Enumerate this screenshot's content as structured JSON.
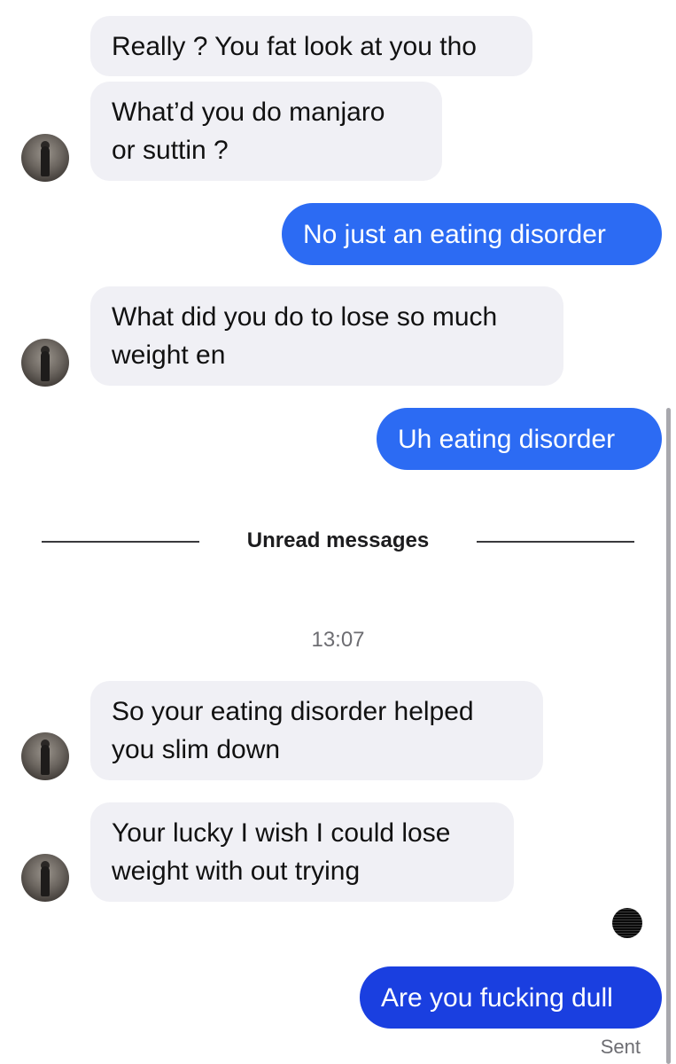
{
  "messages": {
    "m1": "Really ? You fat look at you tho",
    "m2": "What’d you do manjaro\nor suttin ?",
    "m3": "No just an eating disorder",
    "m4": "What did you do to lose so much\nweight en",
    "m5": "Uh eating disorder",
    "m6": "So your eating disorder helped\nyou slim down",
    "m7": "Your lucky I wish I could lose\nweight with out trying",
    "m8": "Are you fucking dull"
  },
  "divider": {
    "label": "Unread messages"
  },
  "timestamp": "13:07",
  "status": {
    "sent": "Sent"
  },
  "colors": {
    "incoming_bubble": "#f0f0f5",
    "outgoing_bubble": "#2c6bf3",
    "outgoing_bubble_latest": "#1a3fe0"
  }
}
